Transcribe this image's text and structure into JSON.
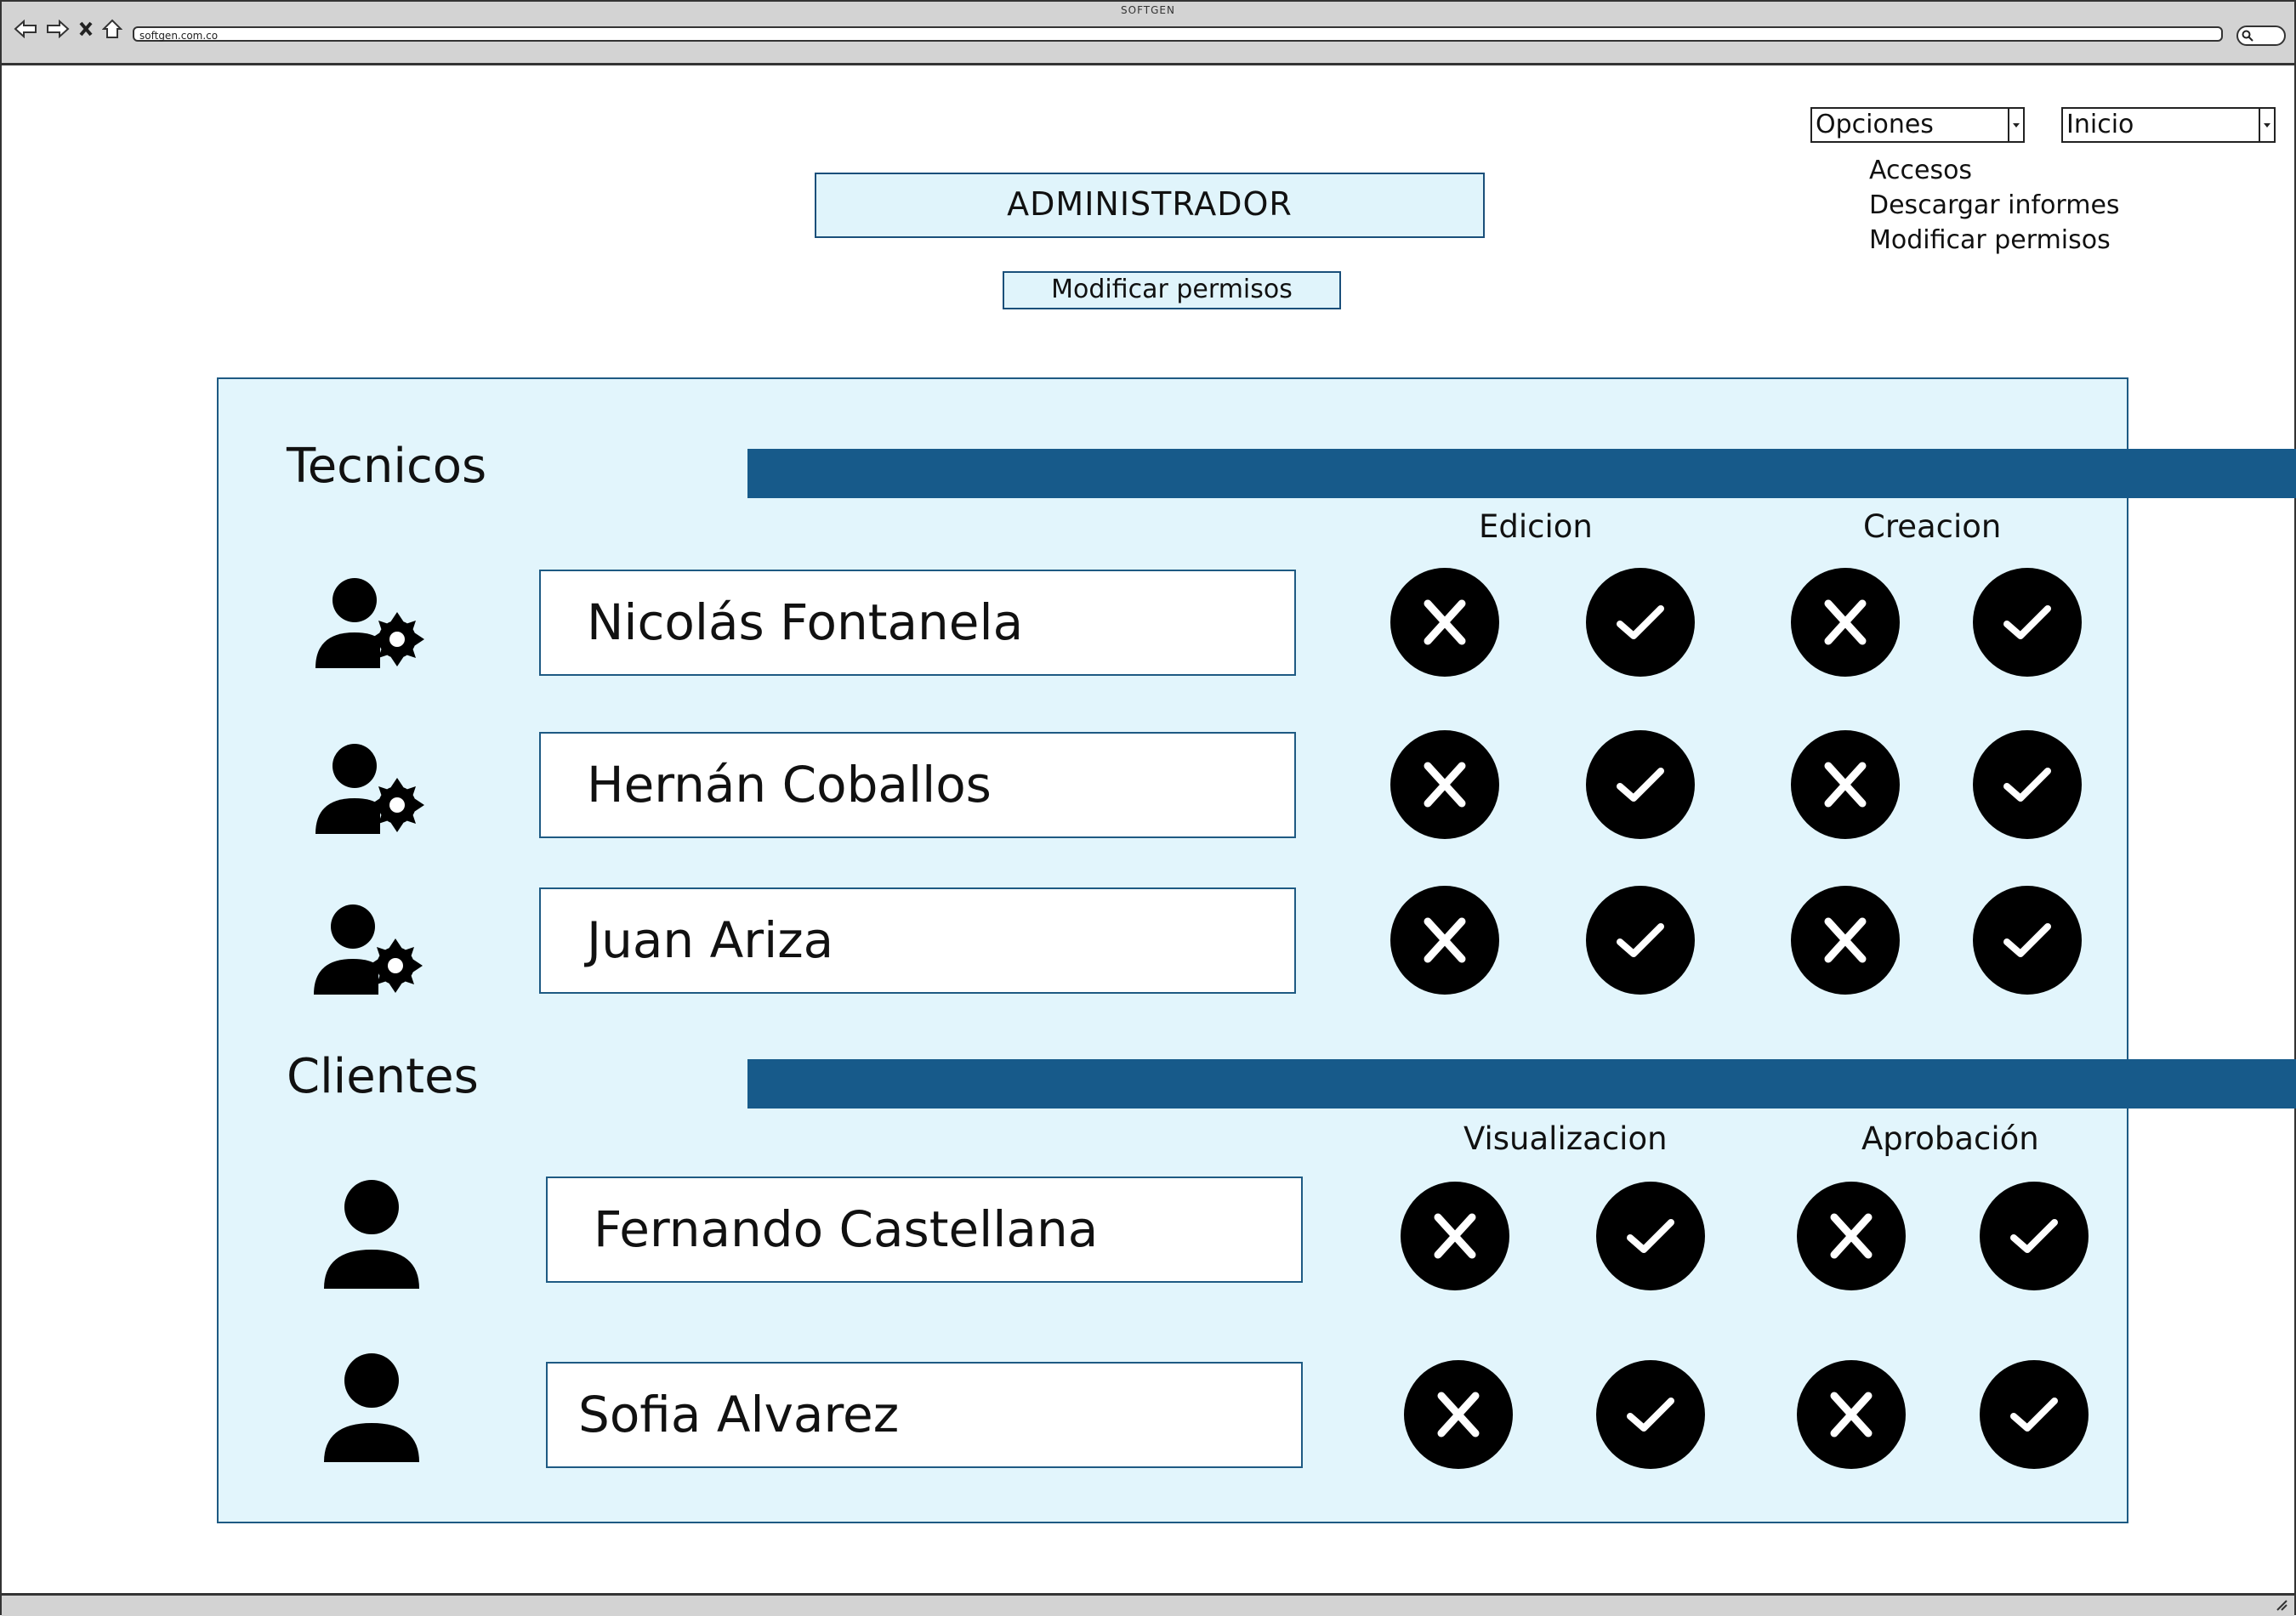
{
  "browser": {
    "window_title": "SOFTGEN",
    "url": "softgen.com.co"
  },
  "header": {
    "dropdown_opciones": "Opciones",
    "dropdown_inicio": "Inicio",
    "menu_items": [
      "Accesos",
      "Descargar informes",
      "Modificar permisos"
    ],
    "title": "ADMINISTRADOR",
    "subtitle_button": "Modificar permisos"
  },
  "tecnicos": {
    "title": "Tecnicos",
    "col1": "Edicion",
    "col2": "Creacion",
    "users": [
      {
        "name": "Nicolás Fontanela"
      },
      {
        "name": "Hernán Coballos"
      },
      {
        "name": "Juan Ariza"
      }
    ]
  },
  "clientes": {
    "title": "Clientes",
    "col1": "Visualizacion",
    "col2": "Aprobación",
    "users": [
      {
        "name": "Fernando Castellana"
      },
      {
        "name": "Sofia Alvarez"
      }
    ]
  },
  "icons": {
    "deny": "x-circle-icon",
    "allow": "check-circle-icon",
    "tecnico": "user-gear-icon",
    "cliente": "user-icon"
  },
  "colors": {
    "section_bar": "#175a8a",
    "panel_bg": "#e2f5fc",
    "box_bg": "#e0f4fb",
    "button_fill": "#000000"
  }
}
